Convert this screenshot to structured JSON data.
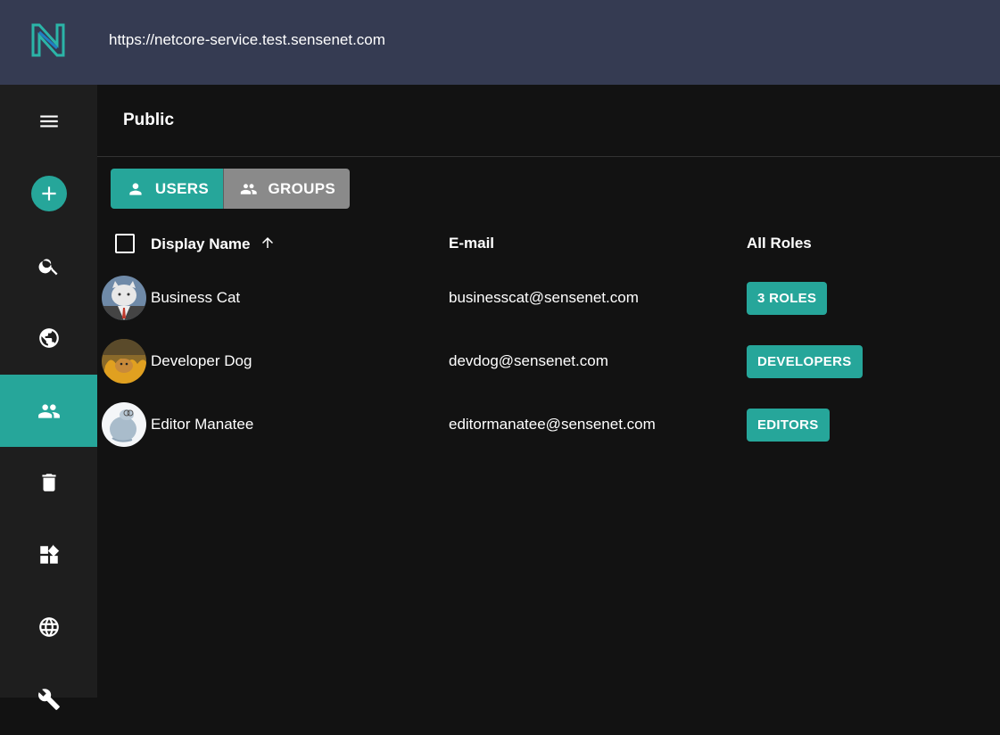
{
  "header": {
    "logo_icon": "sensenet-logo-icon",
    "url": "https://netcore-service.test.sensenet.com"
  },
  "sidebar": {
    "items": [
      {
        "name": "menu",
        "icon": "hamburger-menu-icon"
      },
      {
        "name": "add",
        "icon": "plus-icon"
      },
      {
        "name": "search",
        "icon": "search-icon"
      },
      {
        "name": "content",
        "icon": "globe-icon"
      },
      {
        "name": "users-groups",
        "icon": "people-icon",
        "active": true
      },
      {
        "name": "trash",
        "icon": "trash-icon"
      },
      {
        "name": "content-types",
        "icon": "widgets-icon"
      },
      {
        "name": "localization",
        "icon": "language-icon"
      },
      {
        "name": "setup",
        "icon": "wrench-icon"
      }
    ]
  },
  "page": {
    "title": "Public"
  },
  "toggle": {
    "users_label": "USERS",
    "groups_label": "GROUPS",
    "selected": "USERS"
  },
  "table": {
    "columns": [
      "Display Name",
      "E-mail",
      "All Roles"
    ],
    "sort_column": "Display Name",
    "sort_direction": "ascending",
    "rows": [
      {
        "name": "Business Cat",
        "email": "businesscat@sensenet.com",
        "roles": "3 ROLES"
      },
      {
        "name": "Developer Dog",
        "email": "devdog@sensenet.com",
        "roles": "DEVELOPERS"
      },
      {
        "name": "Editor Manatee",
        "email": "editormanatee@sensenet.com",
        "roles": "EDITORS"
      }
    ]
  },
  "colors": {
    "accent": "#26a69a",
    "topbar": "#353b52",
    "sidebar": "#1e1e1e",
    "background": "#121212",
    "inactive_toggle": "#8a8a8a"
  }
}
